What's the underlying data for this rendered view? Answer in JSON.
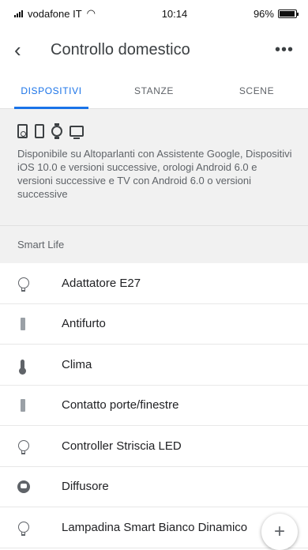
{
  "status": {
    "carrier": "vodafone IT",
    "time": "10:14",
    "battery": "96%",
    "battery_level": 0.96
  },
  "header": {
    "title": "Controllo domestico"
  },
  "tabs": [
    {
      "label": "DISPOSITIVI",
      "active": true
    },
    {
      "label": "STANZE",
      "active": false
    },
    {
      "label": "SCENE",
      "active": false
    }
  ],
  "info": {
    "icons": [
      "speaker-icon",
      "phone-icon",
      "watch-icon",
      "tv-icon"
    ],
    "text": "Disponibile su Altoparlanti con Assistente Google, Dispositivi iOS 10.0 e versioni successive, orologi Android 6.0 e versioni successive e TV con Android 6.0 o versioni successive"
  },
  "section": {
    "label": "Smart Life"
  },
  "devices": [
    {
      "label": "Adattatore E27",
      "icon": "bulb-icon"
    },
    {
      "label": "Antifurto",
      "icon": "sensor-icon"
    },
    {
      "label": "Clima",
      "icon": "thermometer-icon"
    },
    {
      "label": "Contatto porte/finestre",
      "icon": "sensor-icon"
    },
    {
      "label": "Controller Striscia LED",
      "icon": "bulb-icon"
    },
    {
      "label": "Diffusore",
      "icon": "diffuser-icon"
    },
    {
      "label": "Lampadina Smart Bianco Dinamico",
      "icon": "bulb-icon"
    }
  ],
  "fab": {
    "label": "+"
  },
  "colors": {
    "accent": "#1a73e8",
    "panel": "#f1f1f1"
  }
}
